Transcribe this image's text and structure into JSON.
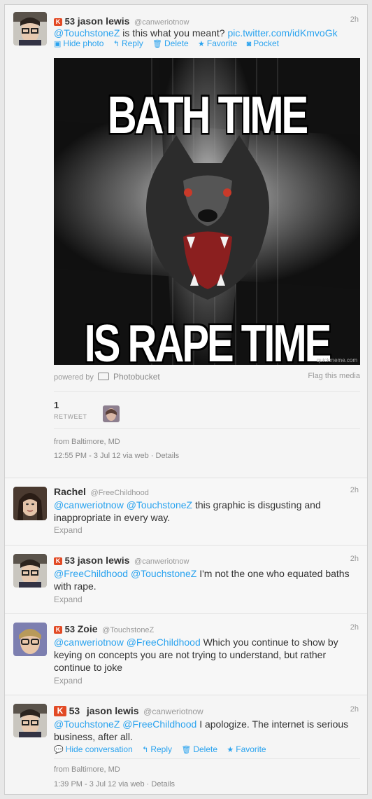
{
  "tweets": [
    {
      "klout": "53",
      "name": "jason lewis",
      "handle": "@canweriotnow",
      "time": "2h",
      "text_plain": "is this what you meant?",
      "mention1": "@TouchstoneZ",
      "link": "pic.twitter.com/idKmvoGk",
      "actions": {
        "hide_photo": "Hide photo",
        "reply": "Reply",
        "delete": "Delete",
        "favorite": "Favorite",
        "pocket": "Pocket"
      },
      "meme": {
        "top": "BATH TIME",
        "bottom": "IS RAPE TIME",
        "watermark": "quickmeme.com"
      },
      "powered_by": "powered by",
      "photobucket": "Photobucket",
      "flag": "Flag this media",
      "retweet_count": "1",
      "retweet_label": "RETWEET",
      "location": "from Baltimore, MD",
      "timestamp": "12:55 PM - 3 Jul 12 via web · Details"
    },
    {
      "name": "Rachel",
      "handle": "@FreeChildhood",
      "time": "2h",
      "mention1": "@canweriotnow",
      "mention2": "@TouchstoneZ",
      "text_plain": "this graphic is disgusting and inappropriate in every way.",
      "expand": "Expand"
    },
    {
      "klout": "53",
      "name": "jason lewis",
      "handle": "@canweriotnow",
      "time": "2h",
      "mention1": "@FreeChildhood",
      "mention2": "@TouchstoneZ",
      "text_plain": "I'm not the one who equated baths with rape.",
      "expand": "Expand"
    },
    {
      "klout": "53",
      "name": "Zoie",
      "handle": "@TouchstoneZ",
      "time": "2h",
      "mention1": "@canweriotnow",
      "mention2": "@FreeChildhood",
      "text_plain": "Which you continue to show by keying on concepts you are not trying to understand, but rather continue to joke",
      "expand": "Expand"
    },
    {
      "klout": "53",
      "name": "jason lewis",
      "handle": "@canweriotnow",
      "time": "2h",
      "mention1": "@TouchstoneZ",
      "mention2": "@FreeChildhood",
      "text_plain": "I apologize. The internet is serious business, after all.",
      "actions": {
        "hide_conversation": "Hide conversation",
        "reply": "Reply",
        "delete": "Delete",
        "favorite": "Favorite"
      },
      "location": "from Baltimore, MD",
      "timestamp": "1:39 PM - 3 Jul 12 via web · Details"
    }
  ],
  "colors": {
    "link": "#2aa3ef",
    "klout": "#e24a25",
    "muted": "#999999"
  },
  "icons": {
    "klout": "klout-icon",
    "photo": "photo-icon",
    "reply": "reply-icon",
    "delete": "trash-icon",
    "favorite": "star-icon",
    "pocket": "pocket-icon",
    "conversation": "speech-bubble-icon",
    "camera": "camera-icon"
  }
}
